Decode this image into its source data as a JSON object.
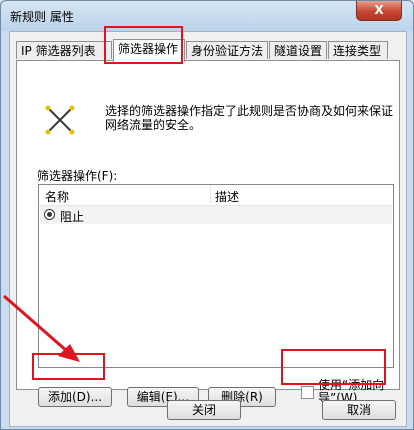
{
  "window": {
    "title": "新规则 属性",
    "close_label": "X"
  },
  "tabs": [
    {
      "label": "IP 筛选器列表"
    },
    {
      "label": "筛选器操作",
      "active": true
    },
    {
      "label": "身份验证方法"
    },
    {
      "label": "隧道设置"
    },
    {
      "label": "连接类型"
    }
  ],
  "panel": {
    "icon": "filter-action-icon",
    "description": "选择的筛选器操作指定了此规则是否协商及如何来保证网络流量的安全。",
    "list_label": "筛选器操作(F):",
    "columns": [
      "名称",
      "描述"
    ],
    "rows": [
      {
        "name": "阻止",
        "desc": ""
      }
    ]
  },
  "buttons": {
    "add": "添加(D)...",
    "edit": "编辑(E)...",
    "delete": "删除(R)",
    "wizard_label": "使用“添加向导”(W)"
  },
  "footer": {
    "close": "关闭",
    "cancel": "取消"
  },
  "colors": {
    "annotation_red": "#e0141d"
  }
}
